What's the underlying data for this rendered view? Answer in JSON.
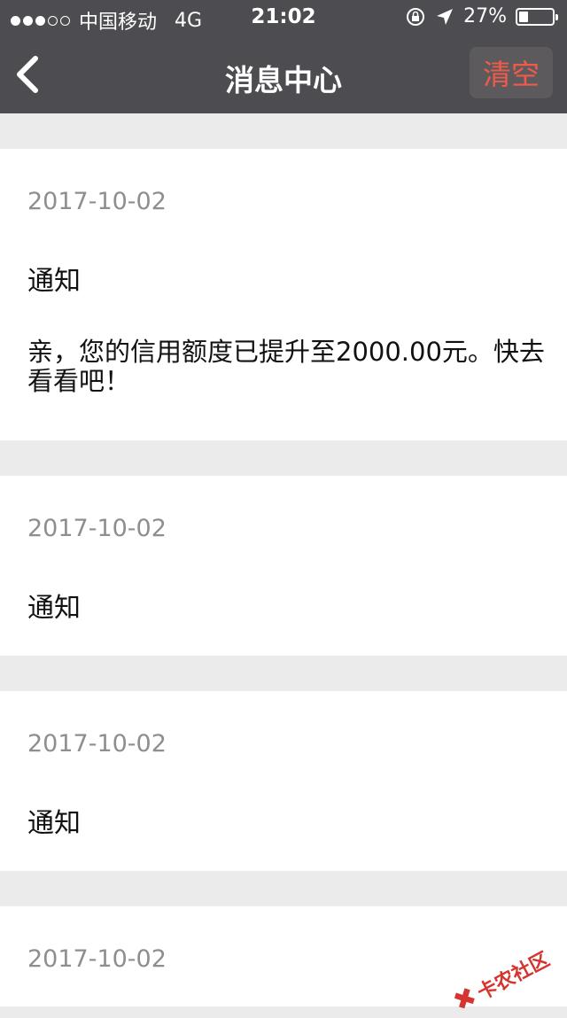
{
  "status_bar": {
    "carrier": "中国移动",
    "network": "4G",
    "time": "21:02",
    "battery_percent_text": "27%",
    "battery_level": 0.27,
    "signal_bars_filled": 3,
    "signal_bars_total": 5
  },
  "nav": {
    "title": "消息中心",
    "clear_label": "清空",
    "clear_color": "#f15a4a",
    "back_icon": "chevron-left-icon"
  },
  "messages": [
    {
      "date": "2017-10-02",
      "title": "通知",
      "body": "亲，您的信用额度已提升至2000.00元。快去看看吧！"
    },
    {
      "date": "2017-10-02",
      "title": "通知"
    },
    {
      "date": "2017-10-02",
      "title": "通知"
    },
    {
      "date": "2017-10-02"
    }
  ],
  "watermark": {
    "text": "卡农社区",
    "color": "#d6342e"
  },
  "colors": {
    "header_bg": "#4d4c50",
    "page_bg": "#ebebeb",
    "card_bg": "#ffffff",
    "date_text": "#8e8e8e"
  }
}
